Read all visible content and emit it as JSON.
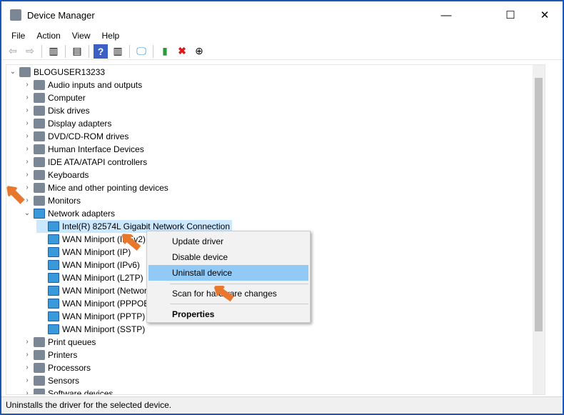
{
  "window": {
    "title": "Device Manager",
    "minimize": "—",
    "maximize": "☐",
    "close": "✕"
  },
  "menu": [
    "File",
    "Action",
    "View",
    "Help"
  ],
  "toolbar": [
    "back",
    "forward",
    "show-hide-console-tree",
    "properties",
    "help",
    "run",
    "scan-hardware",
    "update-driver",
    "uninstall",
    "disable"
  ],
  "tree": {
    "root": "BLOGUSER13233",
    "categories": [
      "Audio inputs and outputs",
      "Computer",
      "Disk drives",
      "Display adapters",
      "DVD/CD-ROM drives",
      "Human Interface Devices",
      "IDE ATA/ATAPI controllers",
      "Keyboards",
      "Mice and other pointing devices",
      "Monitors",
      "Network adapters"
    ],
    "network_children": [
      "Intel(R) 82574L Gigabit Network Connection",
      "WAN Miniport (IKEv2)",
      "WAN Miniport (IP)",
      "WAN Miniport (IPv6)",
      "WAN Miniport (L2TP)",
      "WAN Miniport (Network Monitor)",
      "WAN Miniport (PPPOE)",
      "WAN Miniport (PPTP)",
      "WAN Miniport (SSTP)"
    ],
    "after": [
      "Print queues",
      "Printers",
      "Processors",
      "Sensors",
      "Software devices"
    ]
  },
  "context_menu": {
    "update": "Update driver",
    "disable": "Disable device",
    "uninstall": "Uninstall device",
    "scan": "Scan for hardware changes",
    "properties": "Properties"
  },
  "status": "Uninstalls the driver for the selected device.",
  "colors": {
    "accent": "#1a57b8",
    "highlight": "#91c9f7",
    "arrow": "#e8772e"
  }
}
